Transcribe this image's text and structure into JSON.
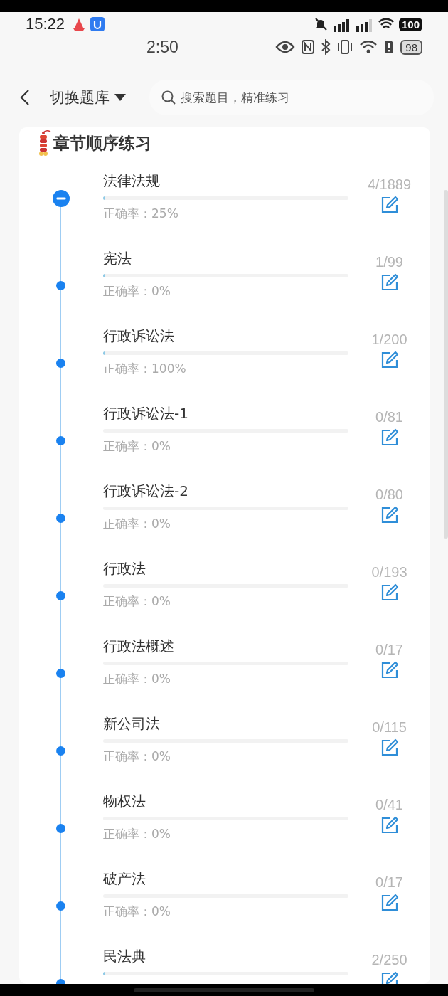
{
  "status_bar": {
    "time": "15:22",
    "battery": "100"
  },
  "status_bar_2": {
    "time": "2:50",
    "battery": "98"
  },
  "header": {
    "switch_label": "切换题库",
    "search": {
      "placeholder": "搜索题目，精准练习"
    }
  },
  "section": {
    "title": "章节顺序练习",
    "chapters": [
      {
        "title": "法律法规",
        "count": "4/1889",
        "accuracy": "正确率：25%",
        "level": 0.002,
        "expanded": true
      },
      {
        "title": "宪法",
        "count": "1/99",
        "accuracy": "正确率：0%",
        "level": 0.01,
        "expanded": false
      },
      {
        "title": "行政诉讼法",
        "count": "1/200",
        "accuracy": "正确率：100%",
        "level": 0.005,
        "expanded": false
      },
      {
        "title": "行政诉讼法-1",
        "count": "0/81",
        "accuracy": "正确率：0%",
        "level": 0,
        "expanded": false
      },
      {
        "title": "行政诉讼法-2",
        "count": "0/80",
        "accuracy": "正确率：0%",
        "level": 0,
        "expanded": false
      },
      {
        "title": "行政法",
        "count": "0/193",
        "accuracy": "正确率：0%",
        "level": 0,
        "expanded": false
      },
      {
        "title": "行政法概述",
        "count": "0/17",
        "accuracy": "正确率：0%",
        "level": 0,
        "expanded": false
      },
      {
        "title": "新公司法",
        "count": "0/115",
        "accuracy": "正确率：0%",
        "level": 0,
        "expanded": false
      },
      {
        "title": "物权法",
        "count": "0/41",
        "accuracy": "正确率：0%",
        "level": 0,
        "expanded": false
      },
      {
        "title": "破产法",
        "count": "0/17",
        "accuracy": "正确率：0%",
        "level": 0,
        "expanded": false
      },
      {
        "title": "民法典",
        "count": "2/250",
        "level": 0.008,
        "expanded": false
      }
    ]
  }
}
